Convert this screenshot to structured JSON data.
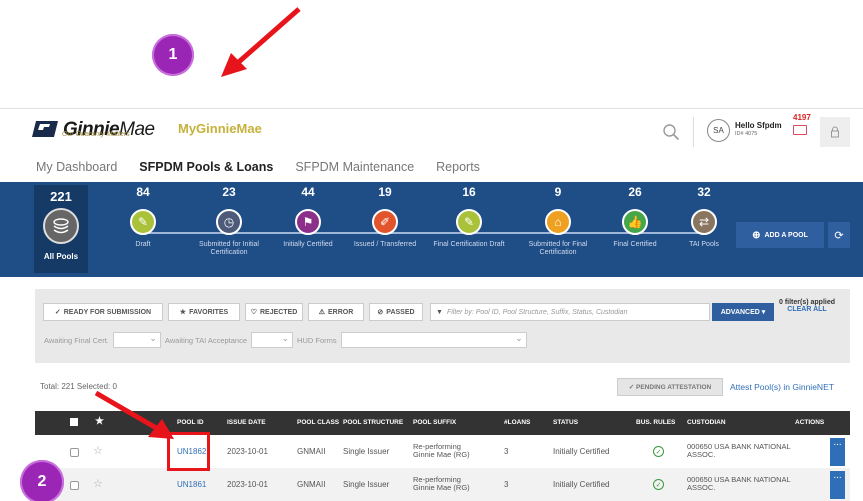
{
  "annotations": {
    "step1": "1",
    "step2": "2"
  },
  "header": {
    "logo_bold": "Ginnie",
    "logo_light": "Mae",
    "logo_tagline": "Our Guaranty Matters",
    "app_name": "MyGinnieMae",
    "avatar_initials": "SA",
    "greeting": "Hello Sfpdm",
    "user_id": "ID# 4075",
    "notification_count": "4197"
  },
  "nav": {
    "tabs": [
      {
        "label": "My Dashboard",
        "active": false
      },
      {
        "label": "SFPDM Pools & Loans",
        "active": true
      },
      {
        "label": "SFPDM Maintenance",
        "active": false
      },
      {
        "label": "Reports",
        "active": false
      }
    ]
  },
  "status_band": {
    "all_pools": {
      "count": "221",
      "label": "All Pools"
    },
    "stages": [
      {
        "count": "84",
        "label": "Draft",
        "color": "#a9c23a",
        "icon": "pencil-icon"
      },
      {
        "count": "23",
        "label": "Submitted for Initial Certification",
        "color": "#4d5a7a",
        "icon": "clock-icon"
      },
      {
        "count": "44",
        "label": "Initially Certified",
        "color": "#8c2f8a",
        "icon": "flag-icon"
      },
      {
        "count": "19",
        "label": "Issued / Transferred",
        "color": "#e2542c",
        "icon": "edit-icon"
      },
      {
        "count": "16",
        "label": "Final Certification Draft",
        "color": "#a9c23a",
        "icon": "pencil-icon"
      },
      {
        "count": "9",
        "label": "Submitted for Final Certification",
        "color": "#f0a020",
        "icon": "inbox-icon"
      },
      {
        "count": "26",
        "label": "Final Certified",
        "color": "#47a64a",
        "icon": "thumbs-up-icon"
      },
      {
        "count": "32",
        "label": "TAI Pools",
        "color": "#8a7560",
        "icon": "transfer-icon"
      }
    ],
    "add_pool_label": "ADD A POOL"
  },
  "filters": {
    "buttons": [
      {
        "label": "READY FOR SUBMISSION",
        "icon": "check-icon"
      },
      {
        "label": "FAVORITES",
        "icon": "star-icon"
      },
      {
        "label": "REJECTED",
        "icon": "reject-icon"
      },
      {
        "label": "ERROR",
        "icon": "warning-icon"
      },
      {
        "label": "PASSED",
        "icon": "passed-icon"
      }
    ],
    "search_placeholder": "Filter by: Pool ID, Pool Structure, Suffix, Status, Custodian",
    "advanced_label": "ADVANCED",
    "applied_text": "0 filter(s) applied",
    "clear_all": "CLEAR ALL",
    "row2": {
      "awaiting_final": "Awaiting Final Cert.",
      "awaiting_tai": "Awaiting TAI Acceptance",
      "hud_forms": "HUD Forms"
    }
  },
  "table": {
    "total_text": "Total: 221 Selected: 0",
    "pending_label": "PENDING ATTESTATION",
    "attest_link": "Attest Pool(s) in GinnieNET",
    "columns": [
      "POOL ID",
      "ISSUE DATE",
      "POOL CLASS",
      "POOL STRUCTURE",
      "POOL SUFFIX",
      "#LOANS",
      "STATUS",
      "BUS. RULES",
      "CUSTODIAN",
      "ACTIONS"
    ],
    "rows": [
      {
        "pool_id": "UN1862",
        "issue_date": "2023-10-01",
        "pool_class": "GNMAII",
        "structure": "Single Issuer",
        "suffix": "Re-performing Ginnie Mae (RG)",
        "loans": "3",
        "status": "Initially Certified",
        "custodian": "000650 USA BANK NATIONAL ASSOC."
      },
      {
        "pool_id": "UN1861",
        "issue_date": "2023-10-01",
        "pool_class": "GNMAII",
        "structure": "Single Issuer",
        "suffix": "Re-performing Ginnie Mae (RG)",
        "loans": "3",
        "status": "Initially Certified",
        "custodian": "000650 USA BANK NATIONAL ASSOC."
      }
    ]
  }
}
